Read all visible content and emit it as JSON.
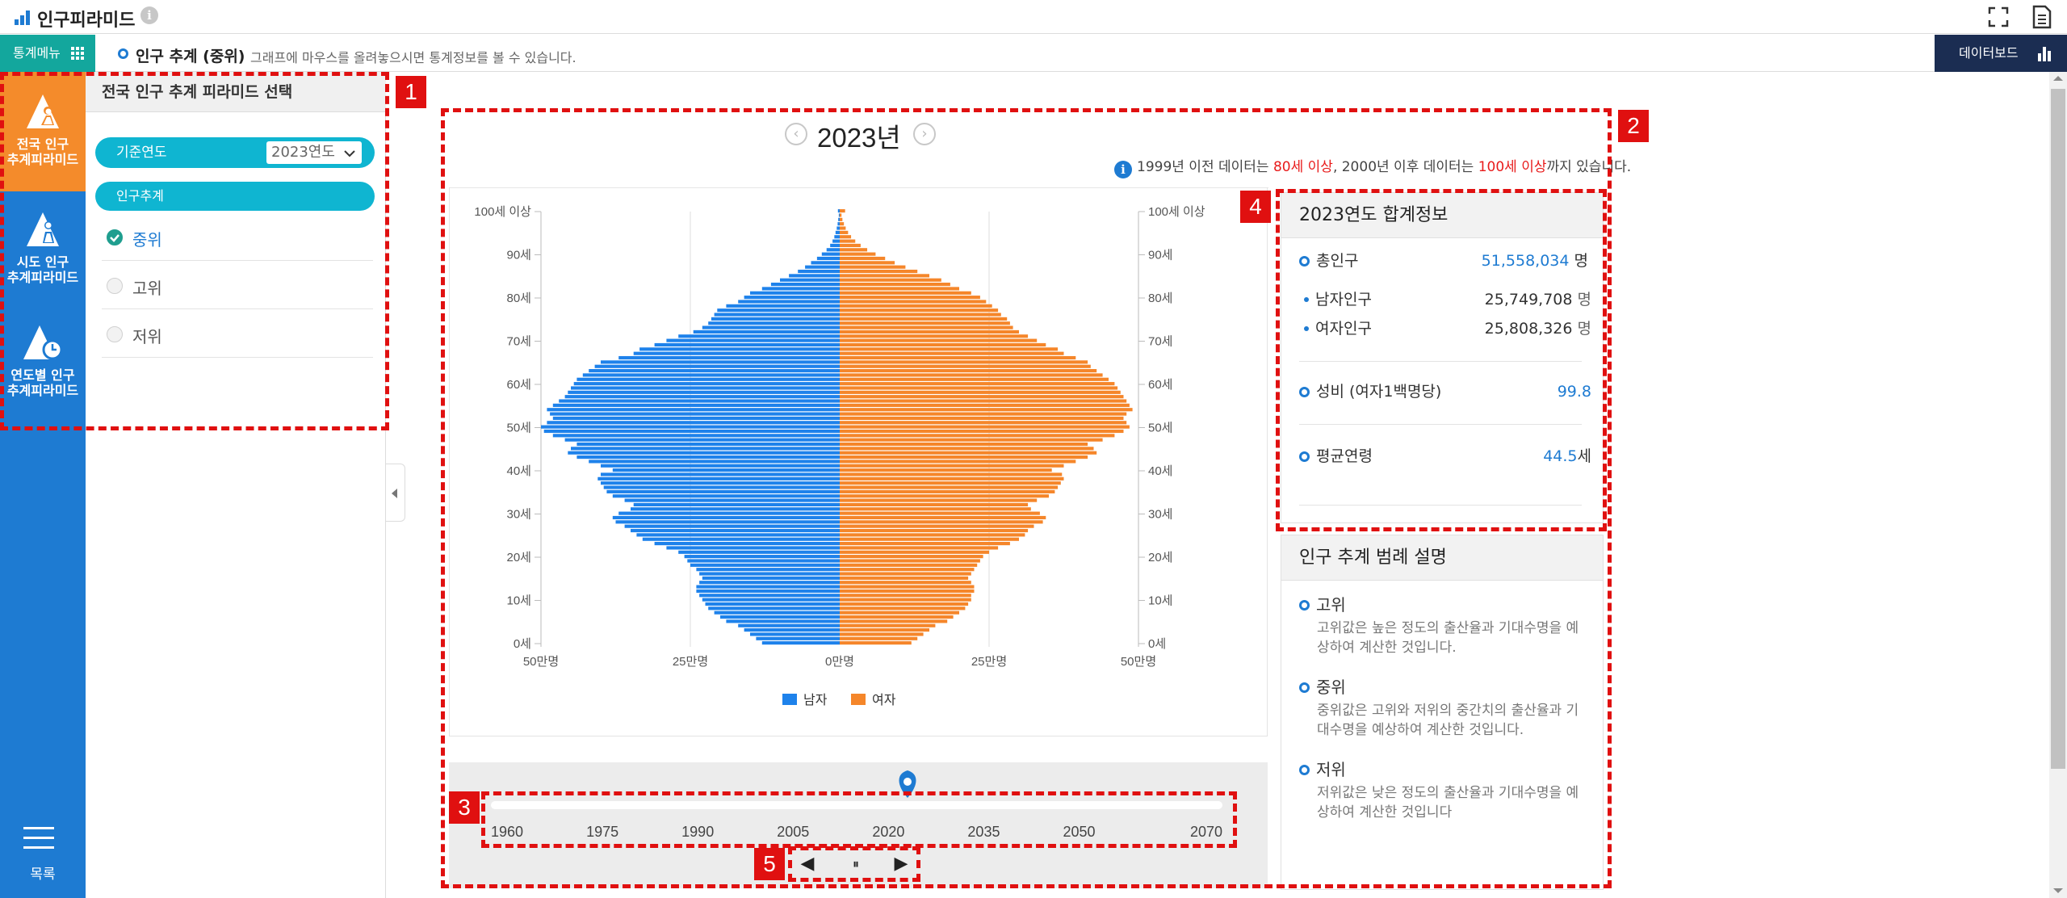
{
  "app": {
    "title": "인구피라미드",
    "info_icon": "i"
  },
  "subbar": {
    "menu_label": "통계메뉴",
    "title": "인구 추계 (중위)",
    "description": "그래프에 마우스를 올려놓으시면 통계정보를 볼 수 있습니다.",
    "dashboard_label": "데이터보드"
  },
  "sidebar": {
    "items": [
      {
        "line1": "전국 인구",
        "line2": "추계피라미드",
        "active": true
      },
      {
        "line1": "시도 인구",
        "line2": "추계피라미드",
        "active": false
      },
      {
        "line1": "연도별 인구",
        "line2": "추계피라미드",
        "active": false
      }
    ],
    "menu_label": "목록"
  },
  "panel": {
    "title": "전국 인구 추계 피라미드 선택",
    "base_year_label": "기준연도",
    "base_year_value": "2023연도",
    "projection_label": "인구추계",
    "options": [
      "중위",
      "고위",
      "저위"
    ],
    "selected_option": "중위"
  },
  "main": {
    "year_title": "2023년",
    "prev_icon": "‹",
    "next_icon": "›",
    "note": {
      "part1": "1999년 이전 데이터는 ",
      "red1": "80세 이상",
      "part2": ", 2000년 이후 데이터는 ",
      "red2": "100세 이상",
      "part3": "까지 있습니다."
    }
  },
  "chart_data": {
    "type": "bar",
    "orientation": "horizontal-pyramid",
    "title": "",
    "y_tick_labels": [
      "0세",
      "10세",
      "20세",
      "30세",
      "40세",
      "50세",
      "60세",
      "70세",
      "80세",
      "90세",
      "100세 이상"
    ],
    "x_tick_labels": [
      "50만명",
      "25만명",
      "0만명",
      "25만명",
      "50만명"
    ],
    "xlim": [
      -500000,
      500000
    ],
    "legend": [
      "남자",
      "여자"
    ],
    "legend_position": "bottom",
    "colors": {
      "male": "#1e82eb",
      "female": "#f5862a"
    },
    "ages": [
      0,
      1,
      2,
      3,
      4,
      5,
      6,
      7,
      8,
      9,
      10,
      11,
      12,
      13,
      14,
      15,
      16,
      17,
      18,
      19,
      20,
      21,
      22,
      23,
      24,
      25,
      26,
      27,
      28,
      29,
      30,
      31,
      32,
      33,
      34,
      35,
      36,
      37,
      38,
      39,
      40,
      41,
      42,
      43,
      44,
      45,
      46,
      47,
      48,
      49,
      50,
      51,
      52,
      53,
      54,
      55,
      56,
      57,
      58,
      59,
      60,
      61,
      62,
      63,
      64,
      65,
      66,
      67,
      68,
      69,
      70,
      71,
      72,
      73,
      74,
      75,
      76,
      77,
      78,
      79,
      80,
      81,
      82,
      83,
      84,
      85,
      86,
      87,
      88,
      89,
      90,
      91,
      92,
      93,
      94,
      95,
      96,
      97,
      98,
      99,
      100
    ],
    "series": [
      {
        "name": "남자",
        "values": [
          130000,
          140000,
          150000,
          160000,
          170000,
          190000,
          200000,
          210000,
          220000,
          225000,
          230000,
          235000,
          240000,
          240000,
          235000,
          230000,
          235000,
          240000,
          250000,
          255000,
          260000,
          270000,
          290000,
          310000,
          330000,
          340000,
          350000,
          360000,
          375000,
          380000,
          370000,
          350000,
          345000,
          360000,
          380000,
          390000,
          395000,
          400000,
          405000,
          400000,
          380000,
          400000,
          420000,
          440000,
          455000,
          450000,
          440000,
          460000,
          480000,
          495000,
          500000,
          490000,
          480000,
          485000,
          490000,
          480000,
          470000,
          460000,
          455000,
          450000,
          445000,
          440000,
          430000,
          420000,
          410000,
          400000,
          370000,
          345000,
          335000,
          310000,
          290000,
          270000,
          245000,
          230000,
          220000,
          215000,
          210000,
          205000,
          190000,
          170000,
          160000,
          150000,
          130000,
          115000,
          100000,
          85000,
          70000,
          58000,
          48000,
          38000,
          30000,
          22000,
          16000,
          12000,
          9000,
          7000,
          5000,
          3500,
          2500,
          1500,
          3000
        ]
      },
      {
        "name": "여자",
        "values": [
          120000,
          130000,
          140000,
          150000,
          160000,
          180000,
          190000,
          200000,
          210000,
          215000,
          220000,
          220000,
          225000,
          225000,
          220000,
          215000,
          220000,
          225000,
          230000,
          235000,
          240000,
          250000,
          265000,
          285000,
          300000,
          310000,
          315000,
          325000,
          340000,
          345000,
          335000,
          320000,
          315000,
          330000,
          350000,
          360000,
          365000,
          370000,
          375000,
          372000,
          355000,
          375000,
          395000,
          415000,
          430000,
          425000,
          415000,
          440000,
          460000,
          475000,
          485000,
          480000,
          475000,
          480000,
          490000,
          485000,
          480000,
          475000,
          470000,
          465000,
          460000,
          450000,
          440000,
          430000,
          420000,
          415000,
          395000,
          375000,
          365000,
          345000,
          330000,
          315000,
          300000,
          290000,
          285000,
          280000,
          270000,
          265000,
          255000,
          245000,
          235000,
          220000,
          200000,
          185000,
          170000,
          150000,
          130000,
          110000,
          92000,
          76000,
          60000,
          46000,
          35000,
          26000,
          19000,
          14000,
          10000,
          7000,
          4500,
          3000,
          9000
        ]
      }
    ]
  },
  "summary": {
    "title": "2023연도 합계정보",
    "total_label": "총인구",
    "total_value": "51,558,034",
    "total_unit": "명",
    "male_label": "남자인구",
    "male_value": "25,749,708",
    "male_unit": "명",
    "female_label": "여자인구",
    "female_value": "25,808,326",
    "female_unit": "명",
    "ratio_label": "성비 (여자1백명당)",
    "ratio_value": "99.8",
    "age_label": "평균연령",
    "age_value": "44.5",
    "age_unit": "세"
  },
  "legend_desc": {
    "title": "인구 추계 범례 설명",
    "items": [
      {
        "name": "고위",
        "desc": "고위값은 높은 정도의 출산율과 기대수명을 예상하여 계산한 것입니다."
      },
      {
        "name": "중위",
        "desc": "중위값은 고위와 저위의 중간치의 출산율과 기대수명을 예상하여 계산한 것입니다."
      },
      {
        "name": "저위",
        "desc": "저위값은 낮은 정도의 출산율과 기대수명을 예상하여 계산한 것입니다"
      }
    ]
  },
  "timeline": {
    "ticks": [
      "1960",
      "1975",
      "1990",
      "2005",
      "2020",
      "2035",
      "2050",
      "2070"
    ],
    "min_year": 1960,
    "max_year": 2070,
    "current_year": 2023
  },
  "controls": {
    "prev": "◀",
    "pause": "⏸",
    "next": "▶"
  },
  "annotations": [
    "1",
    "2",
    "3",
    "4",
    "5"
  ]
}
